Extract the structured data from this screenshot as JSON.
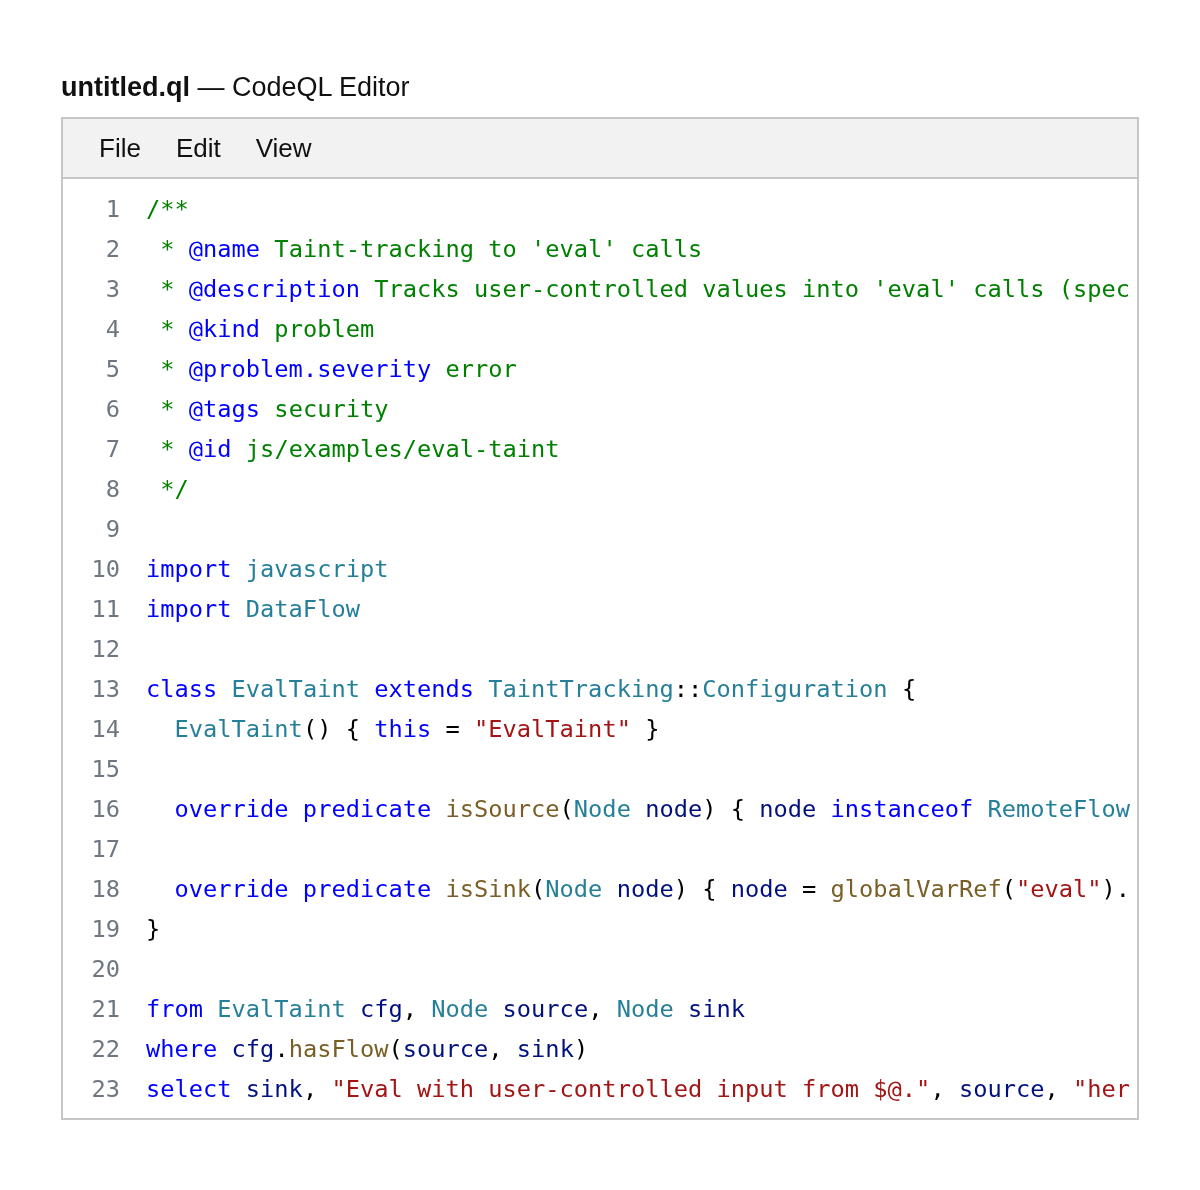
{
  "window": {
    "title": "**untitled.ql** — CodeQL Editor"
  },
  "menu": [
    "File",
    "Edit",
    "View"
  ],
  "code": [
    {
      "number": "1",
      "tokens": [
        {
          "kind": "comment",
          "text": "/**"
        }
      ]
    },
    {
      "number": "2",
      "tokens": [
        {
          "kind": "comment",
          "text": " * "
        },
        {
          "kind": "tag",
          "text": "@name"
        },
        {
          "kind": "comment",
          "text": " Taint-tracking to 'eval' calls"
        }
      ]
    },
    {
      "number": "3",
      "tokens": [
        {
          "kind": "comment",
          "text": " * "
        },
        {
          "kind": "tag",
          "text": "@description"
        },
        {
          "kind": "comment",
          "text": " Tracks user-controlled values into 'eval' calls (spec"
        }
      ]
    },
    {
      "number": "4",
      "tokens": [
        {
          "kind": "comment",
          "text": " * "
        },
        {
          "kind": "tag",
          "text": "@kind"
        },
        {
          "kind": "comment",
          "text": " problem"
        }
      ]
    },
    {
      "number": "5",
      "tokens": [
        {
          "kind": "comment",
          "text": " * "
        },
        {
          "kind": "tag",
          "text": "@problem.severity"
        },
        {
          "kind": "comment",
          "text": " error"
        }
      ]
    },
    {
      "number": "6",
      "tokens": [
        {
          "kind": "comment",
          "text": " * "
        },
        {
          "kind": "tag",
          "text": "@tags"
        },
        {
          "kind": "comment",
          "text": " security"
        }
      ]
    },
    {
      "number": "7",
      "tokens": [
        {
          "kind": "comment",
          "text": " * "
        },
        {
          "kind": "tag",
          "text": "@id"
        },
        {
          "kind": "comment",
          "text": " js/examples/eval-taint"
        }
      ]
    },
    {
      "number": "8",
      "tokens": [
        {
          "kind": "comment",
          "text": " */"
        }
      ]
    },
    {
      "number": "9"
    },
    {
      "number": "10",
      "tokens": [
        {
          "kind": "keyword",
          "text": "import "
        },
        {
          "kind": "type",
          "text": "javascript"
        }
      ]
    },
    {
      "number": "11",
      "tokens": [
        {
          "kind": "keyword",
          "text": "import "
        },
        {
          "kind": "type",
          "text": "DataFlow"
        }
      ]
    },
    {
      "number": "12"
    },
    {
      "number": "13",
      "tokens": [
        {
          "kind": "keyword",
          "text": "class "
        },
        {
          "kind": "type",
          "text": "EvalTaint "
        },
        {
          "kind": "keyword",
          "text": "extends "
        },
        {
          "kind": "type",
          "text": "TaintTracking"
        },
        {
          "kind": "plain",
          "text": "::"
        },
        {
          "kind": "type",
          "text": "Configuration"
        },
        {
          "kind": "plain",
          "text": " {"
        }
      ]
    },
    {
      "number": "14",
      "tokens": [
        {
          "kind": "type",
          "text": "  EvalTaint"
        },
        {
          "kind": "plain",
          "text": "() { "
        },
        {
          "kind": "keyword",
          "text": "this"
        },
        {
          "kind": "plain",
          "text": " = "
        },
        {
          "kind": "string",
          "text": "\"EvalTaint\""
        },
        {
          "kind": "plain",
          "text": " }"
        }
      ]
    },
    {
      "number": "15"
    },
    {
      "number": "16",
      "tokens": [
        {
          "kind": "keyword",
          "text": "  override predicate "
        },
        {
          "kind": "function",
          "text": "isSource"
        },
        {
          "kind": "plain",
          "text": "("
        },
        {
          "kind": "type",
          "text": "Node "
        },
        {
          "kind": "variable",
          "text": "node"
        },
        {
          "kind": "plain",
          "text": ") { "
        },
        {
          "kind": "variable",
          "text": "node "
        },
        {
          "kind": "keyword",
          "text": "instanceof "
        },
        {
          "kind": "type",
          "text": "RemoteFlow"
        }
      ]
    },
    {
      "number": "17"
    },
    {
      "number": "18",
      "tokens": [
        {
          "kind": "keyword",
          "text": "  override predicate "
        },
        {
          "kind": "function",
          "text": "isSink"
        },
        {
          "kind": "plain",
          "text": "("
        },
        {
          "kind": "type",
          "text": "Node "
        },
        {
          "kind": "variable",
          "text": "node"
        },
        {
          "kind": "plain",
          "text": ") { "
        },
        {
          "kind": "variable",
          "text": "node"
        },
        {
          "kind": "plain",
          "text": " = "
        },
        {
          "kind": "function",
          "text": "globalVarRef"
        },
        {
          "kind": "plain",
          "text": "("
        },
        {
          "kind": "string",
          "text": "\"eval\""
        },
        {
          "kind": "plain",
          "text": ")."
        }
      ]
    },
    {
      "number": "19",
      "tokens": [
        {
          "kind": "plain",
          "text": "}"
        }
      ]
    },
    {
      "number": "20"
    },
    {
      "number": "21",
      "tokens": [
        {
          "kind": "keyword",
          "text": "from "
        },
        {
          "kind": "type",
          "text": "EvalTaint "
        },
        {
          "kind": "variable",
          "text": "cfg"
        },
        {
          "kind": "plain",
          "text": ", "
        },
        {
          "kind": "type",
          "text": "Node "
        },
        {
          "kind": "variable",
          "text": "source"
        },
        {
          "kind": "plain",
          "text": ", "
        },
        {
          "kind": "type",
          "text": "Node "
        },
        {
          "kind": "variable",
          "text": "sink"
        }
      ]
    },
    {
      "number": "22",
      "tokens": [
        {
          "kind": "keyword",
          "text": "where "
        },
        {
          "kind": "variable",
          "text": "cfg"
        },
        {
          "kind": "plain",
          "text": "."
        },
        {
          "kind": "function",
          "text": "hasFlow"
        },
        {
          "kind": "plain",
          "text": "("
        },
        {
          "kind": "variable",
          "text": "source"
        },
        {
          "kind": "plain",
          "text": ", "
        },
        {
          "kind": "variable",
          "text": "sink"
        },
        {
          "kind": "plain",
          "text": ")"
        }
      ]
    },
    {
      "number": "23",
      "tokens": [
        {
          "kind": "keyword",
          "text": "select "
        },
        {
          "kind": "variable",
          "text": "sink"
        },
        {
          "kind": "plain",
          "text": ", "
        },
        {
          "kind": "string",
          "text": "\"Eval with user-controlled input from $@.\""
        },
        {
          "kind": "plain",
          "text": ", "
        },
        {
          "kind": "variable",
          "text": "source"
        },
        {
          "kind": "plain",
          "text": ", "
        },
        {
          "kind": "string",
          "text": "\"her"
        }
      ]
    }
  ]
}
